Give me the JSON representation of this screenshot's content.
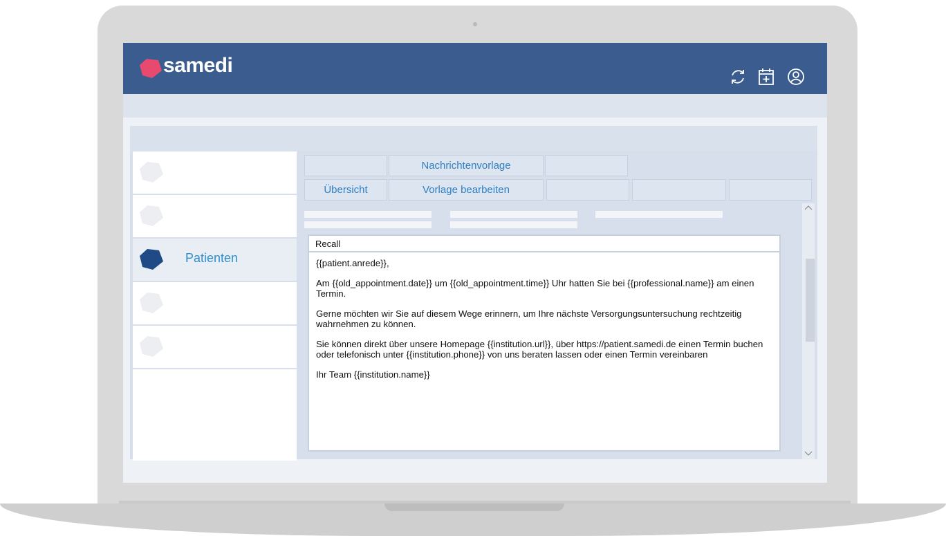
{
  "brand": {
    "name": "samedi",
    "logo_color": "#e8496e",
    "header_color": "#3a5c8f"
  },
  "header_icons": [
    "refresh-icon",
    "calendar-add-icon",
    "user-profile-icon"
  ],
  "sidebar": {
    "items": [
      {
        "label": "",
        "icon": "pentagon-icon",
        "active": false
      },
      {
        "label": "",
        "icon": "pentagon-icon",
        "active": false
      },
      {
        "label": "Patienten",
        "icon": "pentagon-icon",
        "active": true
      },
      {
        "label": "",
        "icon": "pentagon-icon",
        "active": false
      },
      {
        "label": "",
        "icon": "pentagon-icon",
        "active": false
      }
    ]
  },
  "tabs": {
    "row1": [
      "",
      "Nachrichtenvorlage",
      ""
    ],
    "row2": [
      "Übersicht",
      "Vorlage bearbeiten",
      "",
      "",
      ""
    ]
  },
  "editor": {
    "subject": "Recall",
    "body": [
      "{{patient.anrede}},",
      "Am  {{old_appointment.date}} um {{old_appointment.time}} Uhr hatten Sie bei  {{professional.name}} am einen Termin.",
      "Gerne möchten wir Sie auf diesem Wege erinnern, um Ihre nächste Versorgungsuntersuchung rechtzeitig wahrnehmen zu können.",
      "Sie können direkt über unsere Homepage {{institution.url}}, über https://patient.samedi.de einen Termin buchen oder telefonisch unter {{institution.phone}} von uns beraten lassen oder einen Termin vereinbaren",
      "Ihr Team {{institution.name}}"
    ]
  }
}
